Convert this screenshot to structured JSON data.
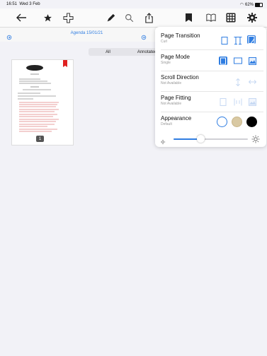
{
  "status": {
    "time": "16:51",
    "date": "Wed 3 Feb",
    "wifi": "wifi-icon",
    "battery_pct": "62%"
  },
  "toolbar": {
    "icons": [
      "back-arrow-icon",
      "star-icon",
      "move-icon",
      "pen-icon",
      "search-icon",
      "share-icon",
      "bookmark-icon",
      "book-icon",
      "grid-icon",
      "gear-icon"
    ]
  },
  "doc": {
    "title": "Agenda 15/01/21"
  },
  "tabs": {
    "all": "All",
    "annotated": "Annotated"
  },
  "thumbnail": {
    "page_number": "1"
  },
  "panel": {
    "transition": {
      "label": "Page Transition",
      "value": "Curl"
    },
    "mode": {
      "label": "Page Mode",
      "value": "Single"
    },
    "scroll": {
      "label": "Scroll Direction",
      "value": "Not Available"
    },
    "fitting": {
      "label": "Page Fitting",
      "value": "Not Available"
    },
    "appearance": {
      "label": "Appearance",
      "value": "Default"
    },
    "brightness_level": 0.37
  },
  "colors": {
    "accent": "#2f7de1",
    "sepia": "#d9c9a3",
    "night": "#000000"
  }
}
